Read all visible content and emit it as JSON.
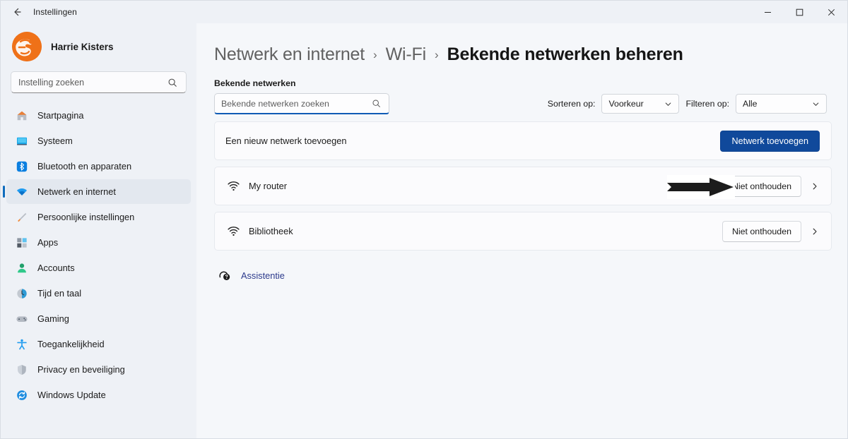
{
  "window": {
    "title": "Instellingen",
    "back_icon": "back-arrow-icon",
    "controls": {
      "minimize": "─",
      "maximize": "☐",
      "close": "✕"
    }
  },
  "sidebar": {
    "profile": {
      "name": "Harrie Kisters",
      "avatar_color": "#ef7118"
    },
    "search": {
      "placeholder": "Instelling zoeken",
      "value": "",
      "icon": "search-icon"
    },
    "items": [
      {
        "label": "Startpagina",
        "icon": "home-icon",
        "selected": false
      },
      {
        "label": "Systeem",
        "icon": "display-icon",
        "selected": false
      },
      {
        "label": "Bluetooth en apparaten",
        "icon": "bluetooth-icon",
        "selected": false
      },
      {
        "label": "Netwerk en internet",
        "icon": "wifi-icon",
        "selected": true
      },
      {
        "label": "Persoonlijke instellingen",
        "icon": "brush-icon",
        "selected": false
      },
      {
        "label": "Apps",
        "icon": "apps-icon",
        "selected": false
      },
      {
        "label": "Accounts",
        "icon": "person-icon",
        "selected": false
      },
      {
        "label": "Tijd en taal",
        "icon": "clock-icon",
        "selected": false
      },
      {
        "label": "Gaming",
        "icon": "gamepad-icon",
        "selected": false
      },
      {
        "label": "Toegankelijkheid",
        "icon": "accessibility-icon",
        "selected": false
      },
      {
        "label": "Privacy en beveiliging",
        "icon": "shield-icon",
        "selected": false
      },
      {
        "label": "Windows Update",
        "icon": "update-icon",
        "selected": false
      }
    ]
  },
  "main": {
    "breadcrumb": [
      {
        "label": "Netwerk en internet",
        "current": false
      },
      {
        "label": "Wi-Fi",
        "current": false
      },
      {
        "label": "Bekende netwerken beheren",
        "current": true
      }
    ],
    "breadcrumb_separator": "›",
    "section_label": "Bekende netwerken",
    "search": {
      "placeholder": "Bekende netwerken zoeken",
      "value": "",
      "icon": "search-icon",
      "focused": true
    },
    "sort": {
      "label": "Sorteren op:",
      "value": "Voorkeur",
      "chevron": "chevron-down-icon"
    },
    "filter": {
      "label": "Filteren op:",
      "value": "Alle",
      "chevron": "chevron-down-icon"
    },
    "add_row": {
      "text": "Een nieuw netwerk toevoegen",
      "button": "Netwerk toevoegen",
      "button_color": "#10499b"
    },
    "networks": [
      {
        "name": "My router",
        "icon": "wifi-icon",
        "action": "Niet onthouden",
        "chevron": "chevron-right-icon",
        "annotated": true
      },
      {
        "name": "Bibliotheek",
        "icon": "wifi-icon",
        "action": "Niet onthouden",
        "chevron": "chevron-right-icon",
        "annotated": false
      }
    ],
    "help": {
      "icon": "help-person-icon",
      "label": "Assistentie",
      "color": "#2c3a8c"
    },
    "annotation": {
      "shape": "arrow-right-annotation",
      "color": "#1c1c1c"
    }
  }
}
